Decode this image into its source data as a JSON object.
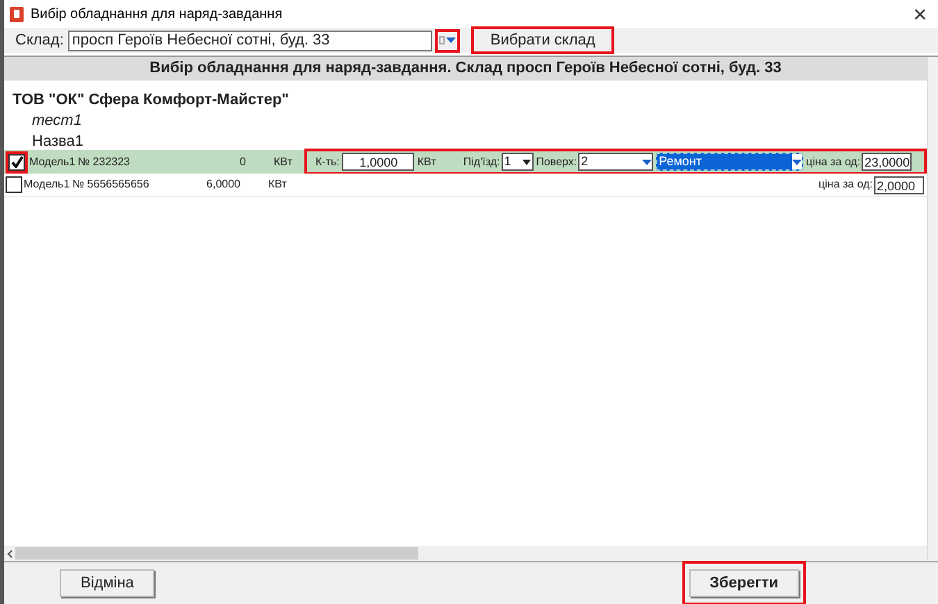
{
  "window": {
    "title": "Вибір обладнання для наряд-завдання",
    "close": "×"
  },
  "toolbar": {
    "label": "Склад:",
    "value": "просп Героїв Небесної сотні, буд. 33",
    "picker_highlighted": true,
    "button": "Вибрати склад",
    "button_highlighted": true
  },
  "header": "Вибір обладнання для наряд-завдання. Склад просп Героїв Небесної сотні, буд. 33",
  "company": "ТОВ \"ОК\" Сфера Комфорт-Майстер\"",
  "group": "тест1",
  "name": "Назва1",
  "rows": [
    {
      "checked": true,
      "checkbox_highlighted": true,
      "model": "Модель1",
      "number": "№ 232323",
      "amount": "0",
      "unit": "КВт",
      "selected": true,
      "details_highlighted": true,
      "details": {
        "qty_label": "К-ть:",
        "qty": "1,0000",
        "qty_unit": "КВт",
        "entrance_label": "Під'їзд:",
        "entrance": "1",
        "floor_label": "Поверх:",
        "floor": "2",
        "work": "Ремонт"
      },
      "price_label": "ціна за од:",
      "price": "23,0000"
    },
    {
      "checked": false,
      "checkbox_highlighted": false,
      "model": "Модель1",
      "number": "№ 5656565656",
      "amount": "6,0000",
      "unit": "КВт",
      "selected": false,
      "price_label": "ціна за од:",
      "price": "2,0000"
    }
  ],
  "buttons": [
    {
      "label": "Відміна",
      "highlighted": false
    },
    {
      "label": "Зберегти",
      "highlighted": true
    }
  ]
}
